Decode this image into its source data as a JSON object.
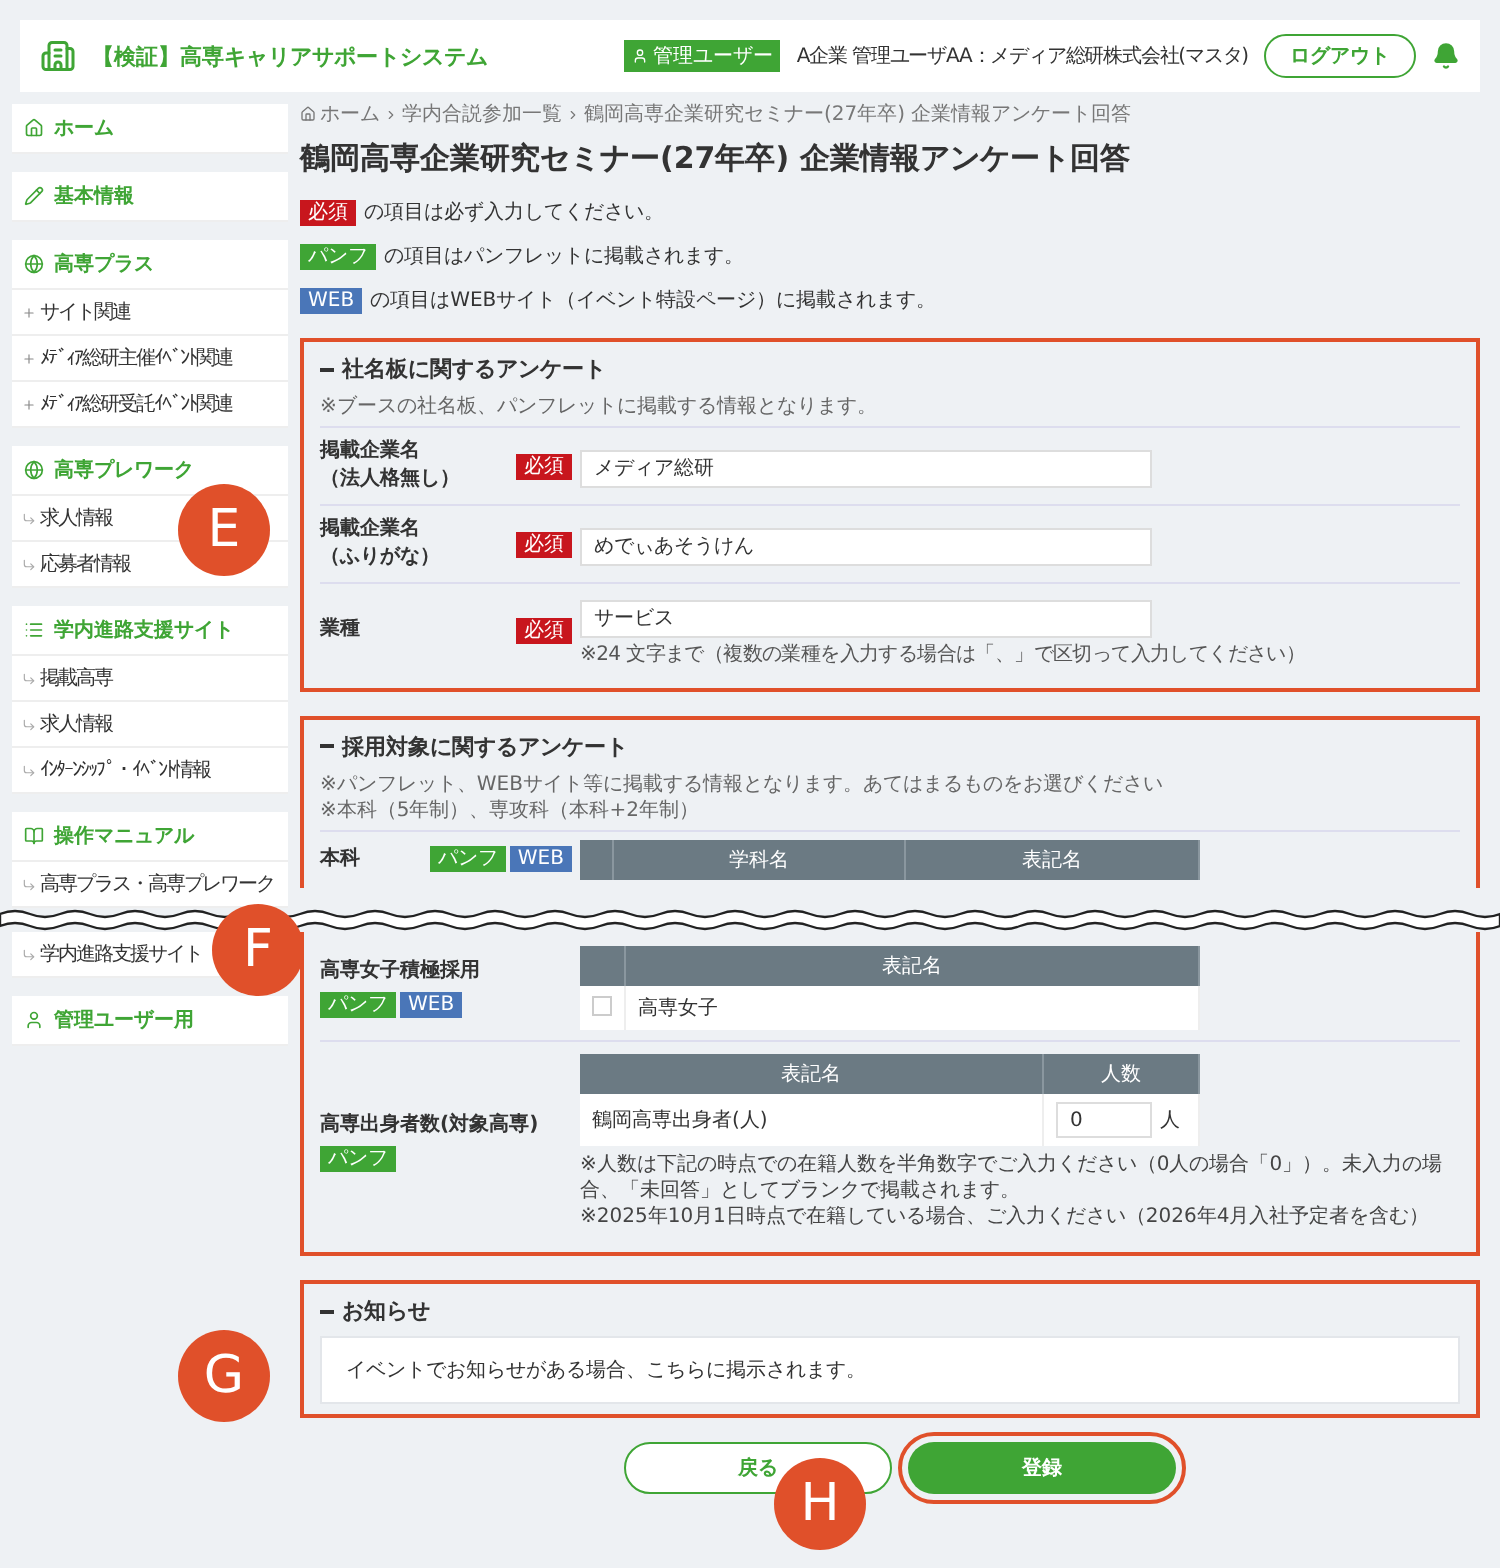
{
  "header": {
    "title": "【検証】高専キャリアサポートシステム",
    "role_badge": "管理ユーザー",
    "user": "A企業 管理ユーザAA：メディア総研株式会社(マスタ)",
    "logout": "ログアウト"
  },
  "page_top": {
    "sidebar": [
      {
        "label": "ホーム"
      },
      {
        "label": "基本情報"
      },
      {
        "label": "高専プラス",
        "items": [
          {
            "label": "サイト関連",
            "kind": "plus"
          },
          {
            "label": "ﾒﾃﾞｨｱ総研主催ｲﾍﾞﾝﾄ関連",
            "kind": "plus"
          },
          {
            "label": "ﾒﾃﾞｨｱ総研受託ｲﾍﾞﾝﾄ関連",
            "kind": "plus"
          }
        ]
      },
      {
        "label": "高専プレワーク",
        "items": [
          {
            "label": "求人情報",
            "kind": "sub"
          },
          {
            "label": "応募者情報",
            "kind": "sub"
          }
        ]
      },
      {
        "label": "学内進路支援サイト",
        "items": [
          {
            "label": "掲載高専",
            "kind": "sub"
          },
          {
            "label": "求人情報",
            "kind": "sub"
          },
          {
            "label": "ｲﾝﾀｰﾝｼｯﾌﾟ・ｲﾍﾞﾝﾄ情報",
            "kind": "sub"
          }
        ]
      },
      {
        "label": "操作マニュアル",
        "items": [
          {
            "label": "高専プラス・高専プレワーク",
            "kind": "sub"
          }
        ]
      }
    ],
    "breadcrumb": [
      "ホーム",
      "学内合説参加一覧",
      "鶴岡高専企業研究セミナー(27年卒) 企業情報アンケート回答"
    ],
    "title": "鶴岡高専企業研究セミナー(27年卒) 企業情報アンケート回答",
    "legend": [
      {
        "badge": {
          "kind": "required",
          "label": "必須"
        },
        "text": "の項目は必ず入力してください。"
      },
      {
        "badge": {
          "kind": "pamphlet",
          "label": "パンフ"
        },
        "text": "の項目はパンフレットに掲載されます。"
      },
      {
        "badge": {
          "kind": "web",
          "label": "WEB"
        },
        "text": "の項目はWEBサイト（イベント特設ページ）に掲載されます。"
      }
    ],
    "sections": [
      {
        "title": "社名板に関するアンケート",
        "highlighted": true,
        "notes": [
          "※ブースの社名板、パンフレットに掲載する情報となります。"
        ],
        "rows": [
          {
            "kind": "input",
            "label": "掲載企業名",
            "sublabel": "（法人格無し）",
            "badges": [
              {
                "kind": "required",
                "label": "必須"
              }
            ],
            "value": "メディア総研"
          },
          {
            "kind": "input",
            "label": "掲載企業名",
            "sublabel": "（ふりがな）",
            "badges": [
              {
                "kind": "required",
                "label": "必須"
              }
            ],
            "value": "めでぃあそうけん"
          },
          {
            "kind": "input",
            "label": "業種",
            "badges": [
              {
                "kind": "required",
                "label": "必須"
              }
            ],
            "value": "サービス",
            "hint": "※24 文字まで（複数の業種を入力する場合は「、」で区切って入力してください）"
          }
        ]
      },
      {
        "title": "採用対象に関するアンケート",
        "highlighted": true,
        "notes": [
          "※パンフレット、WEBサイト等に掲載する情報となります。あてはまるものをお選びください",
          "※本科（5年制）、専攻科（本科+2年制）"
        ],
        "rows": [
          {
            "kind": "header_table",
            "label": "本科",
            "badges": [
              {
                "kind": "pamphlet",
                "label": "パンフ"
              },
              {
                "kind": "web",
                "label": "WEB"
              }
            ],
            "table": {
              "columns": [
                "学科名",
                "表記名"
              ]
            }
          }
        ]
      }
    ]
  },
  "page_bottom": {
    "sidebar": [
      {
        "items": [
          {
            "label": "学内進路支援サイト",
            "kind": "sub"
          }
        ]
      },
      {
        "label": "管理ユーザー用"
      }
    ],
    "sections": [
      {
        "highlighted": true,
        "rows": [
          {
            "kind": "check_table",
            "label": "高専女子積極採用",
            "badges": [
              {
                "kind": "pamphlet",
                "label": "パンフ"
              },
              {
                "kind": "web",
                "label": "WEB"
              }
            ],
            "table": {
              "columns": [
                "表記名"
              ],
              "rows": [
                {
                  "checked": false,
                  "cells": [
                    "高専女子"
                  ]
                }
              ]
            }
          },
          {
            "kind": "count_table",
            "label": "高専出身者数(対象高専)",
            "badges": [
              {
                "kind": "pamphlet",
                "label": "パンフ"
              }
            ],
            "table": {
              "columns": [
                "表記名",
                "人数"
              ],
              "rows": [
                {
                  "name": "鶴岡高専出身者(人)",
                  "value": "0",
                  "unit": "人"
                }
              ]
            },
            "notes": [
              "※人数は下記の時点での在籍人数を半角数字でご入力ください（0人の場合「0」）。未入力の場合、「未回答」としてブランクで掲載されます。",
              "※2025年10月1日時点で在籍している場合、ご入力ください（2026年4月入社予定者を含む）"
            ]
          }
        ]
      },
      {
        "title": "お知らせ",
        "highlighted": true,
        "message": "イベントでお知らせがある場合、こちらに掲示されます。"
      }
    ],
    "buttons": [
      {
        "kind": "secondary",
        "label": "戻る",
        "highlighted": false
      },
      {
        "kind": "primary",
        "label": "登録",
        "highlighted": true
      }
    ]
  },
  "callouts": [
    "E",
    "F",
    "G",
    "H"
  ]
}
